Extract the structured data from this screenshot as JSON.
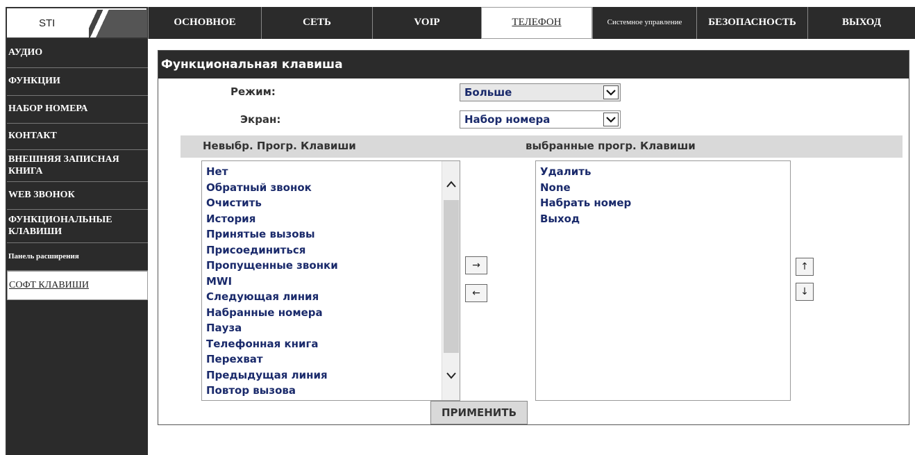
{
  "logo": {
    "text": "STI"
  },
  "nav": {
    "tabs": [
      {
        "label": "ОСНОВНОЕ"
      },
      {
        "label": "СЕТЬ"
      },
      {
        "label": "VOIP"
      },
      {
        "label": "ТЕЛЕФОН"
      },
      {
        "label": "Системное управление"
      },
      {
        "label": "БЕЗОПАСНОСТЬ"
      },
      {
        "label": "ВЫХОД"
      }
    ],
    "active_tab": "ТЕЛЕФОН"
  },
  "sidebar": {
    "items": [
      {
        "label": "АУДИО"
      },
      {
        "label": "ФУНКЦИИ"
      },
      {
        "label": "НАБОР НОМЕРА"
      },
      {
        "label": "КОНТАКТ"
      },
      {
        "label": "ВНЕШНЯЯ ЗАПИСНАЯ КНИГА"
      },
      {
        "label": "WEB ЗВОНОК"
      },
      {
        "label": "ФУНКЦИОНАЛЬНЫЕ КЛАВИШИ"
      },
      {
        "label": "Панель расширения"
      },
      {
        "label": "СОФТ КЛАВИШИ"
      }
    ],
    "active_item": "СОФТ КЛАВИШИ"
  },
  "panel": {
    "title": "Функциональная клавиша",
    "mode": {
      "label": "Режим:",
      "value": "Больше"
    },
    "screen": {
      "label": "Экран:",
      "value": "Набор номера"
    },
    "unselected_header": "Невыбр. Прогр. Клавиши",
    "selected_header": "выбранные прогр. Клавиши",
    "unselected_items": [
      "Нет",
      "Обратный звонок",
      "Очистить",
      "История",
      "Принятые вызовы",
      "Присоединиться",
      "Пропущенные звонки",
      "MWI",
      "Следующая линия",
      "Набранные номера",
      "Пауза",
      "Телефонная книга",
      "Перехват",
      "Предыдущая линия",
      "Повтор вызова"
    ],
    "selected_items": [
      "Удалить",
      "None",
      "Набрать номер",
      "Выход"
    ],
    "move_right": "→",
    "move_left": "←",
    "move_up": "↑",
    "move_down": "↓",
    "apply_label": "ПРИМЕНИТЬ"
  },
  "colors": {
    "dark_bg": "#2b2b2b",
    "list_text": "#1a2a6b",
    "header_grey": "#d9d9d9"
  }
}
